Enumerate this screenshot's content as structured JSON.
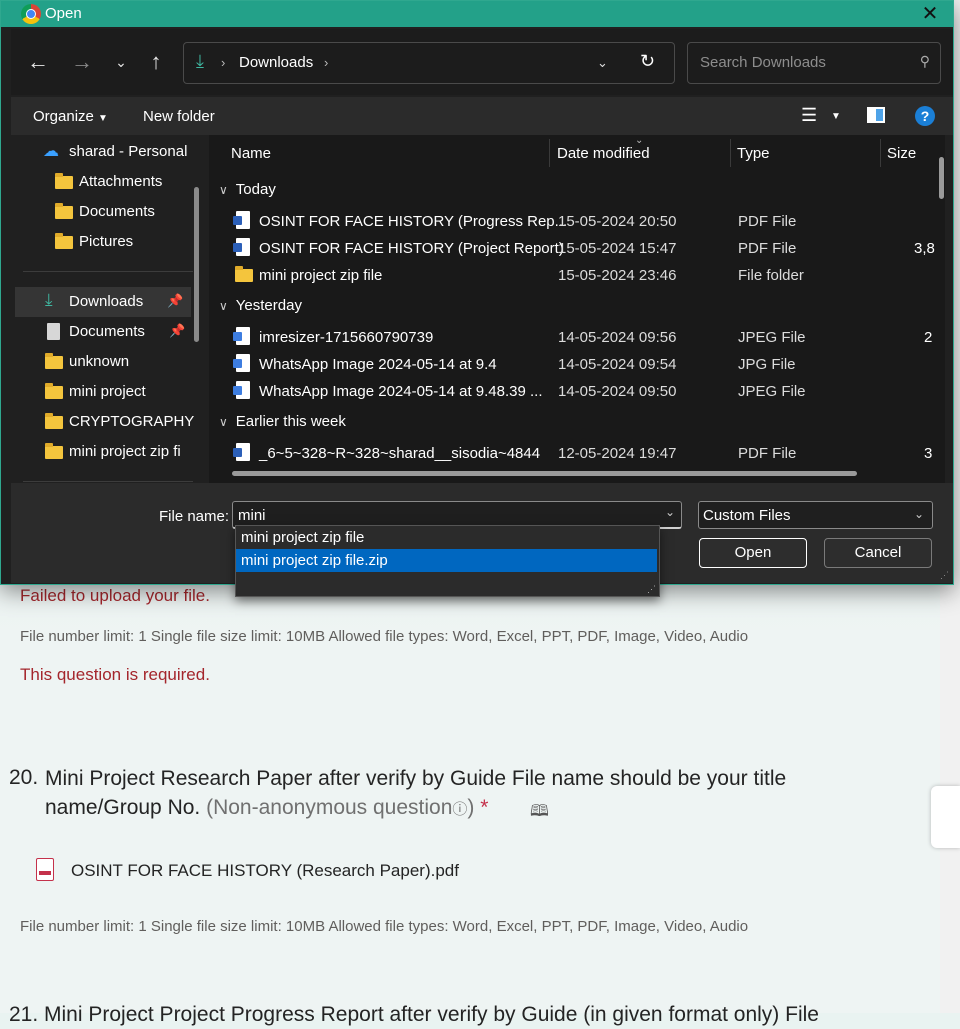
{
  "dialog": {
    "title": "Open",
    "address": {
      "segments": [
        "Downloads"
      ]
    },
    "search_placeholder": "Search Downloads",
    "commands": {
      "organize": "Organize",
      "new_folder": "New folder"
    },
    "nav_pane": {
      "personal": "sharad - Personal",
      "personal_children": [
        "Attachments",
        "Documents",
        "Pictures"
      ],
      "quick_access": [
        {
          "label": "Downloads",
          "pinned": true,
          "selected": true
        },
        {
          "label": "Documents",
          "pinned": true
        },
        {
          "label": "unknown"
        },
        {
          "label": "mini project"
        },
        {
          "label": "CRYPTOGRAPHY"
        },
        {
          "label": "mini project zip fi"
        }
      ]
    },
    "columns": {
      "name": "Name",
      "date": "Date modified",
      "type": "Type",
      "size": "Size"
    },
    "groups": [
      {
        "label": "Today",
        "files": [
          {
            "name": "OSINT FOR FACE HISTORY (Progress Rep...",
            "date": "15-05-2024 20:50",
            "type": "PDF File",
            "size": "",
            "icon": "document-icon"
          },
          {
            "name": "OSINT FOR FACE HISTORY (Project Report)",
            "date": "15-05-2024 15:47",
            "type": "PDF File",
            "size": "3,8",
            "icon": "document-icon"
          },
          {
            "name": "mini project zip file",
            "date": "15-05-2024 23:46",
            "type": "File folder",
            "size": "",
            "icon": "folder-icon"
          }
        ]
      },
      {
        "label": "Yesterday",
        "files": [
          {
            "name": "imresizer-1715660790739",
            "date": "14-05-2024 09:56",
            "type": "JPEG File",
            "size": "2",
            "icon": "image-icon"
          },
          {
            "name": "WhatsApp Image 2024-05-14 at 9.4",
            "date": "14-05-2024 09:54",
            "type": "JPG File",
            "size": "",
            "icon": "image-icon"
          },
          {
            "name": "WhatsApp Image 2024-05-14 at 9.48.39 ...",
            "date": "14-05-2024 09:50",
            "type": "JPEG File",
            "size": "",
            "icon": "image-icon"
          }
        ]
      },
      {
        "label": "Earlier this week",
        "files": [
          {
            "name": "_6~5~328~R~328~sharad__sisodia~4844",
            "date": "12-05-2024 19:47",
            "type": "PDF File",
            "size": "3",
            "icon": "document-icon"
          }
        ]
      }
    ],
    "file_name_label": "File name:",
    "file_name_value": "mini",
    "file_type": "Custom Files",
    "open_button": "Open",
    "cancel_button": "Cancel",
    "autocomplete": [
      {
        "label": "mini project zip file"
      },
      {
        "label": "mini project zip file.zip",
        "selected": true
      }
    ]
  },
  "form": {
    "upload_error": "Failed to upload your file.",
    "limit_text": "File number limit: 1   Single file size limit: 10MB   Allowed file types: Word, Excel, PPT, PDF, Image, Video, Audio",
    "required_error": "This question is required.",
    "question20": {
      "number": "20.",
      "title_line1": "Mini Project Research Paper after verify by Guide File name should be your title",
      "title_line2": "name/Group No.",
      "note": "(Non-anonymous question",
      "info_glyph": "ⓘ",
      "note_close": ")",
      "required_mark": "*",
      "uploaded_file": "OSINT FOR FACE HISTORY (Research Paper).pdf",
      "limit_text": "File number limit: 1   Single file size limit: 10MB   Allowed file types: Word, Excel, PPT, PDF, Image, Video, Audio"
    },
    "question21_partial": "21. Mini Project Project Progress Report after verify by Guide (in given format only) File"
  },
  "colors": {
    "titlebar": "#23a189",
    "selection": "#0067c0",
    "error": "#a4262c"
  }
}
